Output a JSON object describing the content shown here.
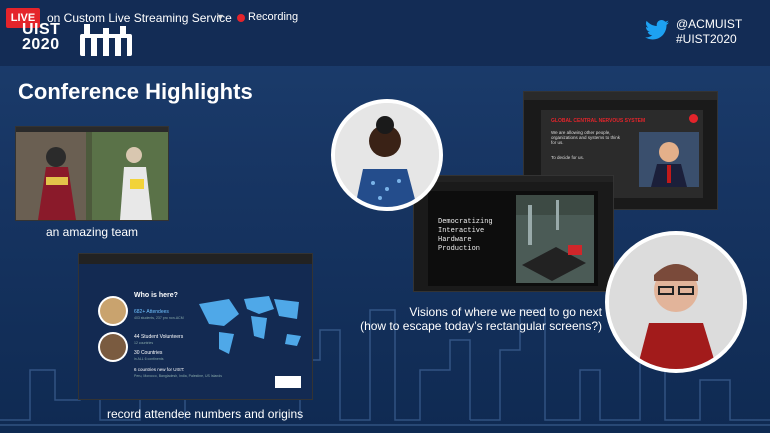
{
  "stream": {
    "live_label": "LIVE",
    "service_label": "on Custom Live Streaming Service",
    "recording_label": "Recording"
  },
  "brand": {
    "logo_line1": "UIST",
    "logo_line2": "2020",
    "handle": "@ACMUIST",
    "hashtag": "#UIST2020"
  },
  "slide": {
    "title": "Conference Highlights",
    "captions": {
      "team": "an amazing team",
      "attendees": "record attendee numbers and origins",
      "visions_line1": "Visions of where we need to go next",
      "visions_line2": "(how to escape today’s rectangular screens?)"
    },
    "attendee_panel": {
      "heading": "Who is here?",
      "stat1": "682+ Attendees",
      "stat1_sub": "403 students, 237 pro non-ACM",
      "stat2": "44 Student Volunteers",
      "stat2_sub": "12 countries",
      "stat3": "30 Countries",
      "stat3_sub": "in ALL 6 continents",
      "stat4": "6 countries new for UIST:",
      "stat4_sub": "Peru, Morocco, Bangladesh, India, Palestine, US Islands"
    },
    "keynote_slide": {
      "heading": "GLOBAL CENTRAL NERVOUS SYSTEM",
      "line1": "We are allowing other people, organizations and systems to think for us.",
      "line2": "To decide for us."
    },
    "hardware_slide": {
      "line1": "Democratizing",
      "line2": "Interactive",
      "line3": "Hardware",
      "line4": "Production"
    }
  },
  "colors": {
    "accent_red": "#e4242b",
    "twitter_blue": "#1da1f2"
  }
}
